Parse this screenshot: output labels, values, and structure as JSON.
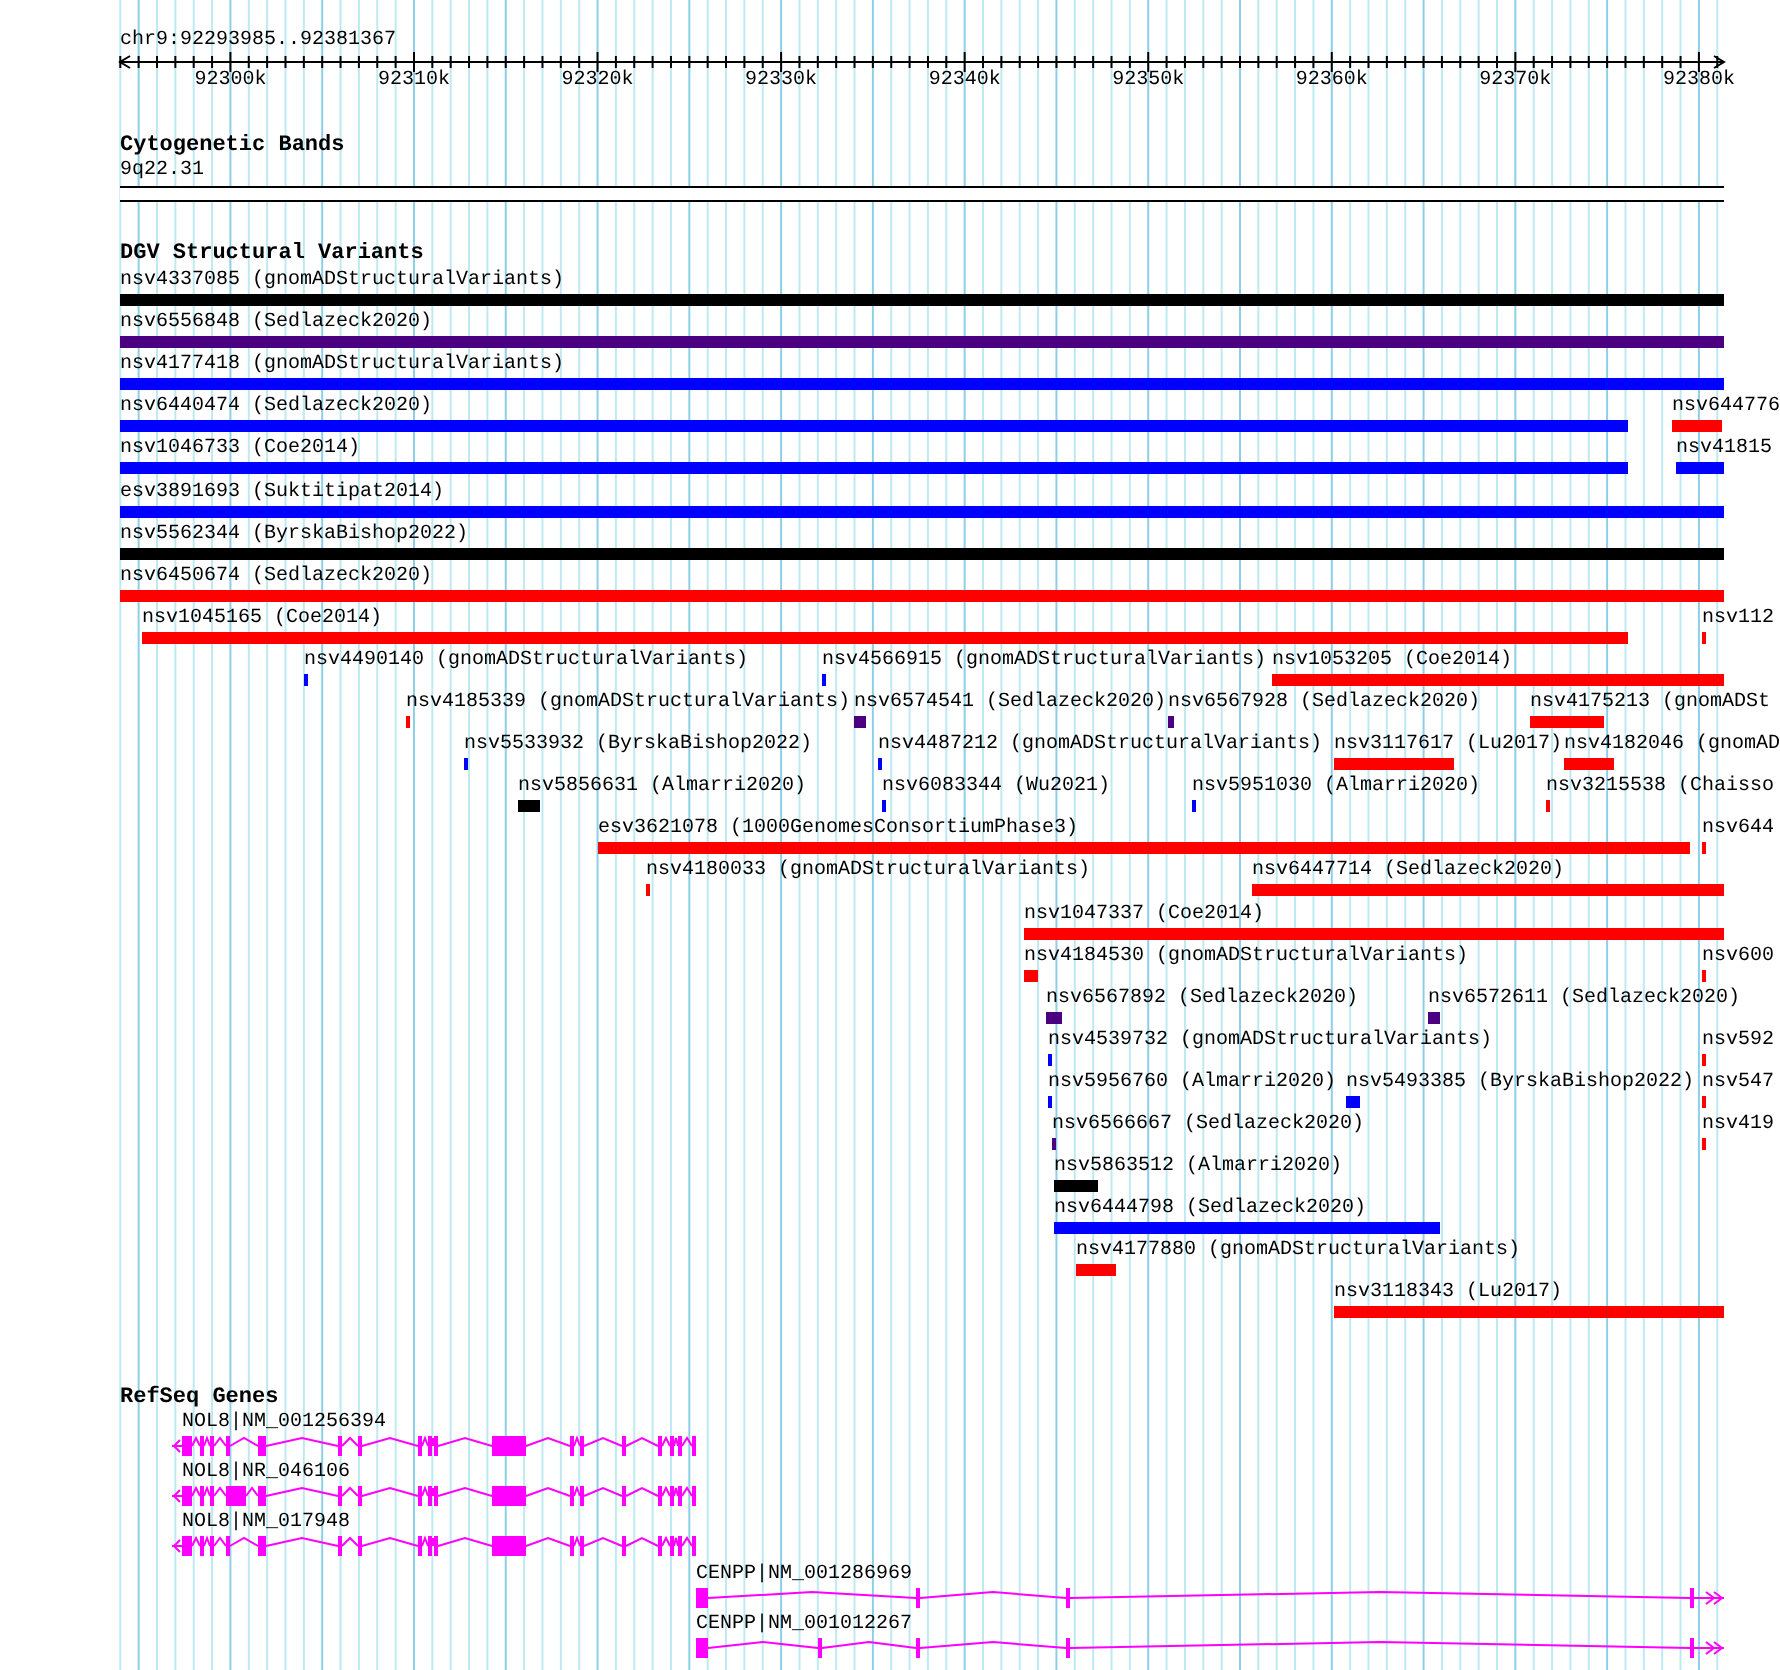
{
  "axis": {
    "location": "chr9:92293985..92381367",
    "ticks": [
      "92300k",
      "92310k",
      "92320k",
      "92330k",
      "92340k",
      "92350k",
      "92360k",
      "92370k",
      "92380k"
    ]
  },
  "tracks": [
    {
      "kind": "cytoband",
      "title": "Cytogenetic Bands",
      "band": "9q22.31"
    },
    {
      "kind": "variants",
      "title": "DGV Structural Variants",
      "features": [
        {
          "label": "nsv4337085 (gnomADStructuralVariants)",
          "color": "#000000"
        },
        {
          "label": "nsv6556848 (Sedlazeck2020)",
          "color": "#4b0082"
        },
        {
          "label": "nsv4177418 (gnomADStructuralVariants)",
          "color": "#0000ff"
        },
        {
          "label": "nsv6440474 (Sedlazeck2020)",
          "color": "#0000ff"
        },
        {
          "label": "nsv644776",
          "color": "#ff0000"
        },
        {
          "label": "nsv1046733 (Coe2014)",
          "color": "#0000ff"
        },
        {
          "label": "nsv41815",
          "color": "#0000ff"
        },
        {
          "label": "esv3891693 (Suktitipat2014)",
          "color": "#0000ff"
        },
        {
          "label": "nsv5562344 (ByrskaBishop2022)",
          "color": "#000000"
        },
        {
          "label": "nsv6450674 (Sedlazeck2020)",
          "color": "#ff0000"
        },
        {
          "label": "nsv1045165 (Coe2014)",
          "color": "#ff0000"
        },
        {
          "label": "nsv112",
          "color": "#ff0000"
        },
        {
          "label": "nsv4490140 (gnomADStructuralVariants)",
          "color": "#0000ff"
        },
        {
          "label": "nsv4566915 (gnomADStructuralVariants)",
          "color": "#0000ff"
        },
        {
          "label": "nsv1053205 (Coe2014)",
          "color": "#ff0000"
        },
        {
          "label": "nsv4185339 (gnomADStructuralVariants)",
          "color": "#ff0000"
        },
        {
          "label": "nsv6574541 (Sedlazeck2020)",
          "color": "#4b0082"
        },
        {
          "label": "nsv6567928 (Sedlazeck2020)",
          "color": "#4b0082"
        },
        {
          "label": "nsv4175213 (gnomADSt",
          "color": "#ff0000"
        },
        {
          "label": "nsv5533932 (ByrskaBishop2022)",
          "color": "#0000ff"
        },
        {
          "label": "nsv4487212 (gnomADStructuralVariants)",
          "color": "#0000ff"
        },
        {
          "label": "nsv3117617 (Lu2017)",
          "color": "#ff0000"
        },
        {
          "label": "nsv4182046 (gnomAD",
          "color": "#ff0000"
        },
        {
          "label": "nsv5856631 (Almarri2020)",
          "color": "#000000"
        },
        {
          "label": "nsv6083344 (Wu2021)",
          "color": "#0000ff"
        },
        {
          "label": "nsv5951030 (Almarri2020)",
          "color": "#0000ff"
        },
        {
          "label": "nsv3215538 (Chaisso",
          "color": "#ff0000"
        },
        {
          "label": "esv3621078 (1000GenomesConsortiumPhase3)",
          "color": "#ff0000"
        },
        {
          "label": "nsv644",
          "color": "#ff0000"
        },
        {
          "label": "nsv4180033 (gnomADStructuralVariants)",
          "color": "#ff0000"
        },
        {
          "label": "nsv6447714 (Sedlazeck2020)",
          "color": "#ff0000"
        },
        {
          "label": "nsv1047337 (Coe2014)",
          "color": "#ff0000"
        },
        {
          "label": "nsv4184530 (gnomADStructuralVariants)",
          "color": "#ff0000"
        },
        {
          "label": "nsv600",
          "color": "#ff0000"
        },
        {
          "label": "nsv6567892 (Sedlazeck2020)",
          "color": "#4b0082"
        },
        {
          "label": "nsv6572611 (Sedlazeck2020)",
          "color": "#4b0082"
        },
        {
          "label": "nsv4539732 (gnomADStructuralVariants)",
          "color": "#0000ff"
        },
        {
          "label": "nsv592",
          "color": "#ff0000"
        },
        {
          "label": "nsv5956760 (Almarri2020)",
          "color": "#0000ff"
        },
        {
          "label": "nsv5493385 (ByrskaBishop2022)",
          "color": "#0000ff"
        },
        {
          "label": "nsv547",
          "color": "#ff0000"
        },
        {
          "label": "nsv6566667 (Sedlazeck2020)",
          "color": "#4b0082"
        },
        {
          "label": "nsv419",
          "color": "#ff0000"
        },
        {
          "label": "nsv5863512 (Almarri2020)",
          "color": "#000000"
        },
        {
          "label": "nsv6444798 (Sedlazeck2020)",
          "color": "#0000ff"
        },
        {
          "label": "nsv4177880 (gnomADStructuralVariants)",
          "color": "#ff0000"
        },
        {
          "label": "nsv3118343 (Lu2017)",
          "color": "#ff0000"
        }
      ]
    },
    {
      "kind": "genes",
      "title": "RefSeq Genes",
      "features": [
        {
          "label": "NOL8|NM_001256394",
          "reverse_strand": true
        },
        {
          "label": "NOL8|NR_046106",
          "reverse_strand": true
        },
        {
          "label": "NOL8|NM_017948",
          "reverse_strand": true
        },
        {
          "label": "CENPP|NM_001286969",
          "reverse_strand": false
        },
        {
          "label": "CENPP|NM_001012267",
          "reverse_strand": false
        }
      ]
    }
  ]
}
